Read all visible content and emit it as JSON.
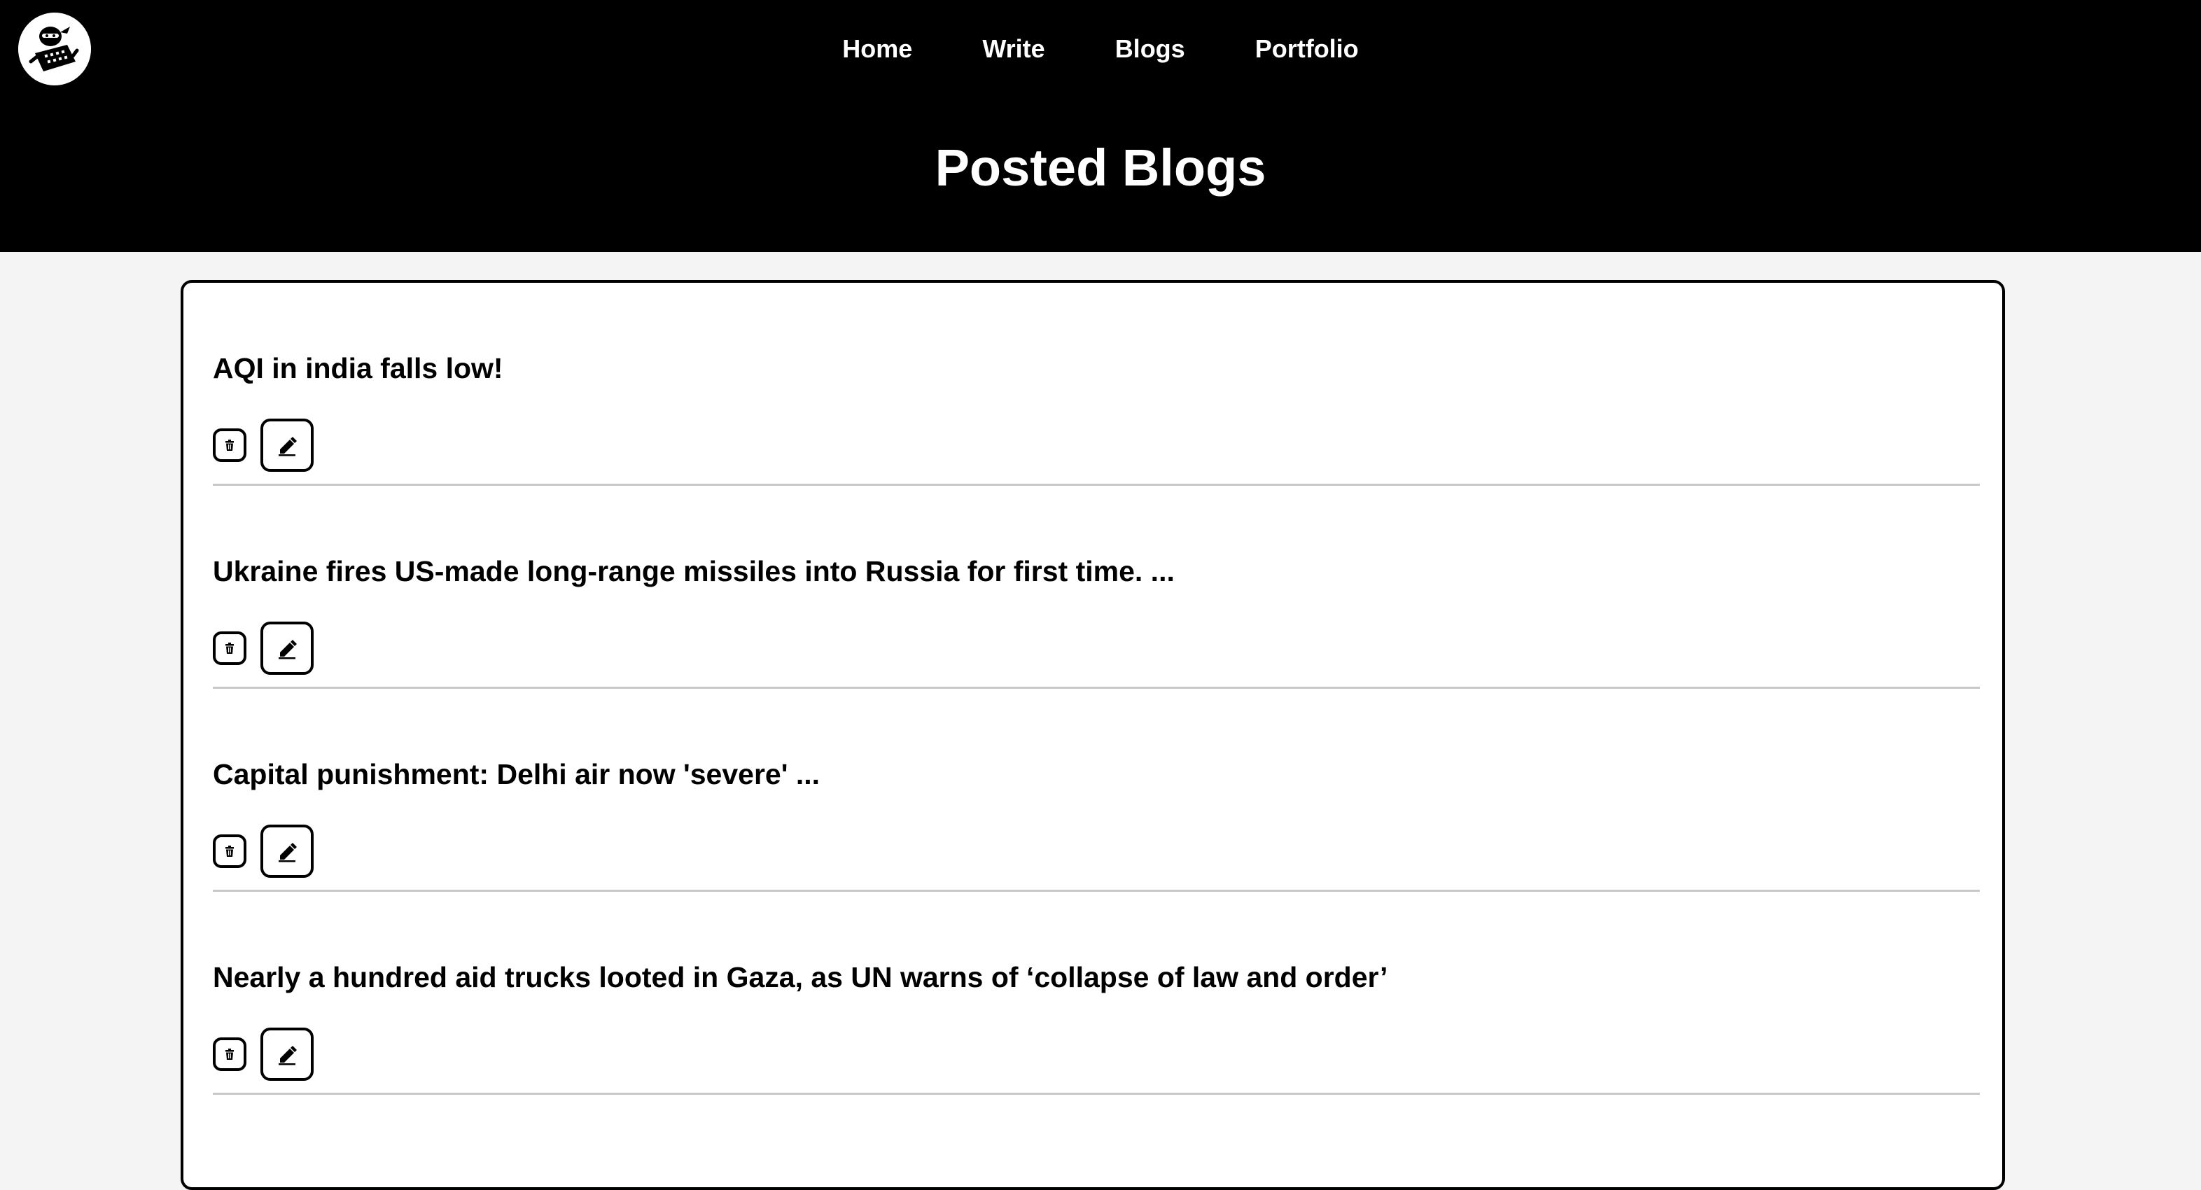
{
  "nav": {
    "items": [
      {
        "label": "Home"
      },
      {
        "label": "Write"
      },
      {
        "label": "Blogs"
      },
      {
        "label": "Portfolio"
      }
    ]
  },
  "header": {
    "title": "Posted Blogs",
    "logo_icon": "ninja-hacker-logo-icon"
  },
  "posts": [
    {
      "title": "AQI in india falls low!",
      "delete_icon": "trash-icon",
      "edit_icon": "pencil-icon"
    },
    {
      "title": "Ukraine fires US-made long-range missiles into Russia for first time. ...",
      "delete_icon": "trash-icon",
      "edit_icon": "pencil-icon"
    },
    {
      "title": "Capital punishment: Delhi air now 'severe' ...",
      "delete_icon": "trash-icon",
      "edit_icon": "pencil-icon"
    },
    {
      "title": "Nearly a hundred aid trucks looted in Gaza, as UN warns of ‘collapse of law and order’",
      "delete_icon": "trash-icon",
      "edit_icon": "pencil-icon"
    }
  ],
  "colors": {
    "header_bg": "#000000",
    "page_bg": "#f4f4f4",
    "card_bg": "#ffffff",
    "divider": "#c8c8c8"
  }
}
